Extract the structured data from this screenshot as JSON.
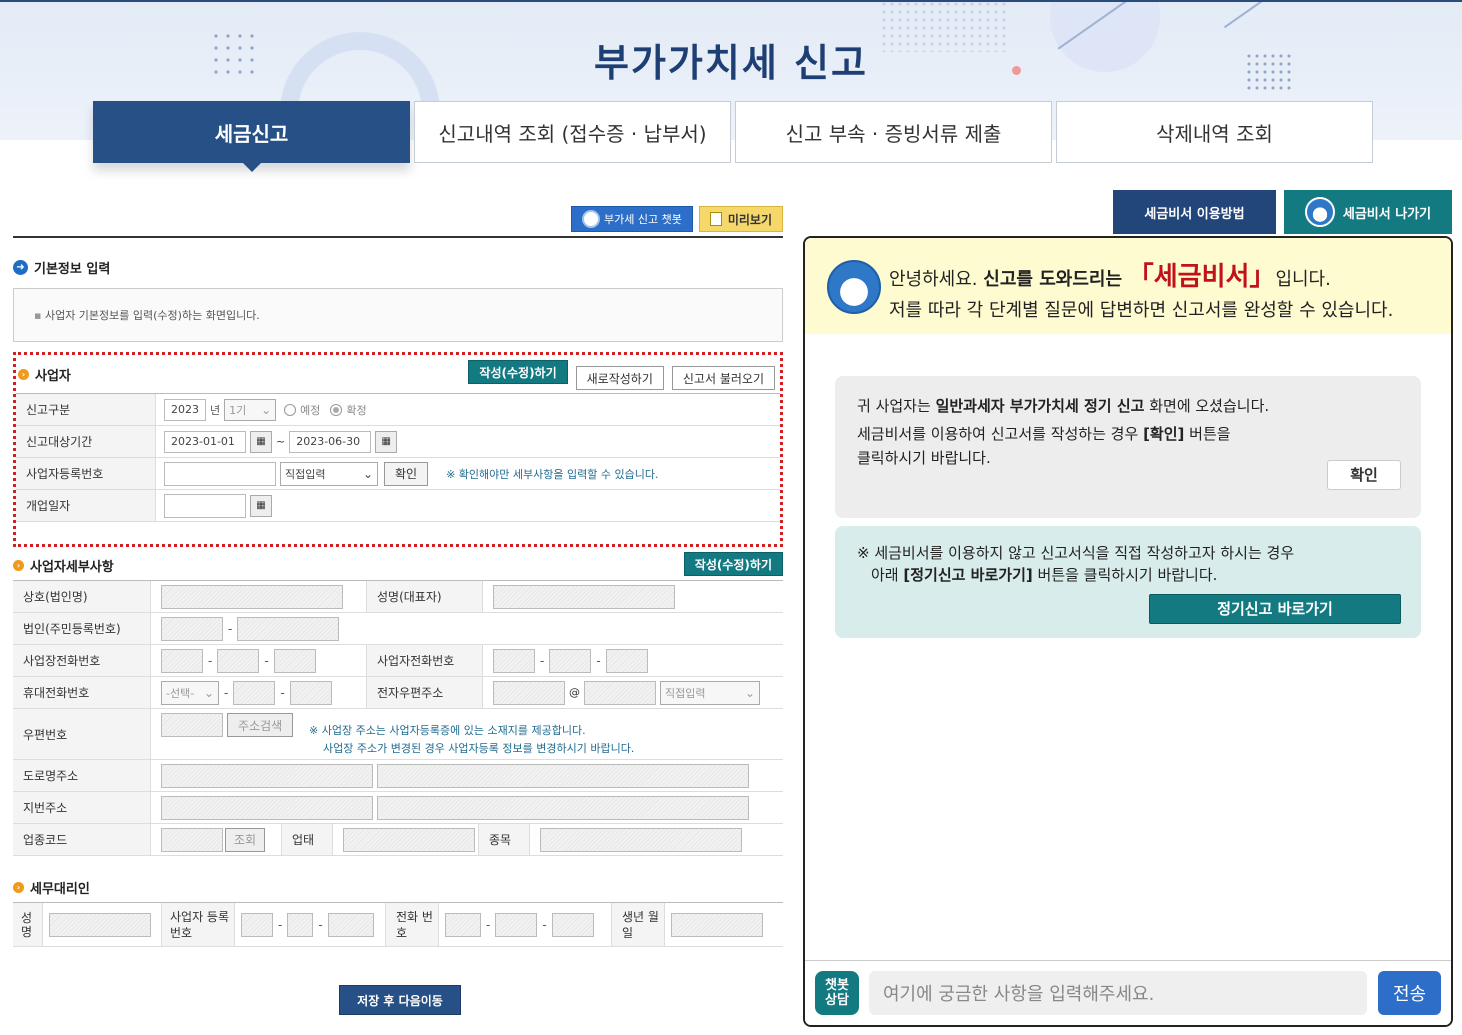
{
  "header": {
    "title": "부가가치세 신고"
  },
  "tabs": [
    {
      "label": "세금신고"
    },
    {
      "label": "신고내역 조회 (접수증 · 납부서)"
    },
    {
      "label": "신고 부속 · 증빙서류 제출"
    },
    {
      "label": "삭제내역 조회"
    }
  ],
  "toolbar": {
    "chatbot_label": "부가세 신고 챗봇",
    "preview_label": "미리보기"
  },
  "basic": {
    "title": "기본정보 입력",
    "info": "사업자 기본정보를 입력(수정)하는 화면입니다."
  },
  "business": {
    "title": "사업자",
    "edit_btn": "작성(수정)하기",
    "new_btn": "새로작성하기",
    "load_btn": "신고서 불러오기",
    "type_label": "신고구분",
    "year": "2023",
    "year_unit": "년",
    "period_select": "1기",
    "radio_expected": "예정",
    "radio_final": "확정",
    "period_label": "신고대상기간",
    "date_from": "2023-01-01",
    "date_sep": "~",
    "date_to": "2023-06-30",
    "regno_label": "사업자등록번호",
    "regno_select": "직접입력",
    "confirm_btn": "확인",
    "regno_note": "※ 확인해야만 세부사항을 입력할 수 있습니다.",
    "opendate_label": "개업일자"
  },
  "detail": {
    "title": "사업자세부사항",
    "edit_btn": "작성(수정)하기",
    "name_label": "상호(법인명)",
    "rep_label": "성명(대표자)",
    "corpno_label": "법인(주민등록번호)",
    "phone_label": "사업장전화번호",
    "phone2_label": "사업자전화번호",
    "mobile_label": "휴대전화번호",
    "mobile_select": "-선택-",
    "email_label": "전자우편주소",
    "email_at": "@",
    "email_select": "직접입력",
    "zip_label": "우편번호",
    "zip_btn": "주소검색",
    "zip_note1": "※ 사업장 주소는 사업자등록증에 있는 소재지를 제공합니다.",
    "zip_note2": "사업장 주소가 변경된 경우 사업자등록 정보를 변경하시기 바랍니다.",
    "road_label": "도로명주소",
    "jibun_label": "지번주소",
    "industry_label": "업종코드",
    "industry_btn": "조회",
    "biz_type_label": "업태",
    "item_label": "종목"
  },
  "agent": {
    "title": "세무대리인",
    "name_label": "성명",
    "regno_label": "사업자 등록번호",
    "phone_label": "전화 번호",
    "birth_label": "생년 월일"
  },
  "save_btn": "저장 후 다음이동",
  "right": {
    "howto_btn": "세금비서 이용방법",
    "exit_btn": "세금비서 나가기",
    "greet_prefix": "안녕하세요.",
    "greet_bold": "신고를 도와드리는",
    "greet_brand": "「세금비서」",
    "greet_suffix": "입니다.",
    "greet_line2": "저를 따라 각 단계별 질문에 답변하면 신고서를 완성할 수 있습니다.",
    "msg1_a": "귀 사업자는",
    "msg1_b": "일반과세자 부가가치세 정기 신고",
    "msg1_c": "화면에 오셨습니다.",
    "msg1_line2": "세금비서를 이용하여 신고서를 작성하는 경우",
    "msg1_line2b": "[확인]",
    "msg1_line2c": "버튼을",
    "msg1_line3": "클릭하시기 바랍니다.",
    "msg1_btn": "확인",
    "msg2_line1": "※ 세금비서를 이용하지 않고 신고서식을 직접 작성하고자 하시는 경우",
    "msg2_line2a": "아래",
    "msg2_line2b": "[정기신고 바로가기]",
    "msg2_line2c": "버튼을 클릭하시기 바랍니다.",
    "msg2_btn": "정기신고 바로가기",
    "chat_icon": "챗봇 상담",
    "chat_placeholder": "여기에 궁금한 사항을 입력해주세요.",
    "send_btn": "전송"
  }
}
